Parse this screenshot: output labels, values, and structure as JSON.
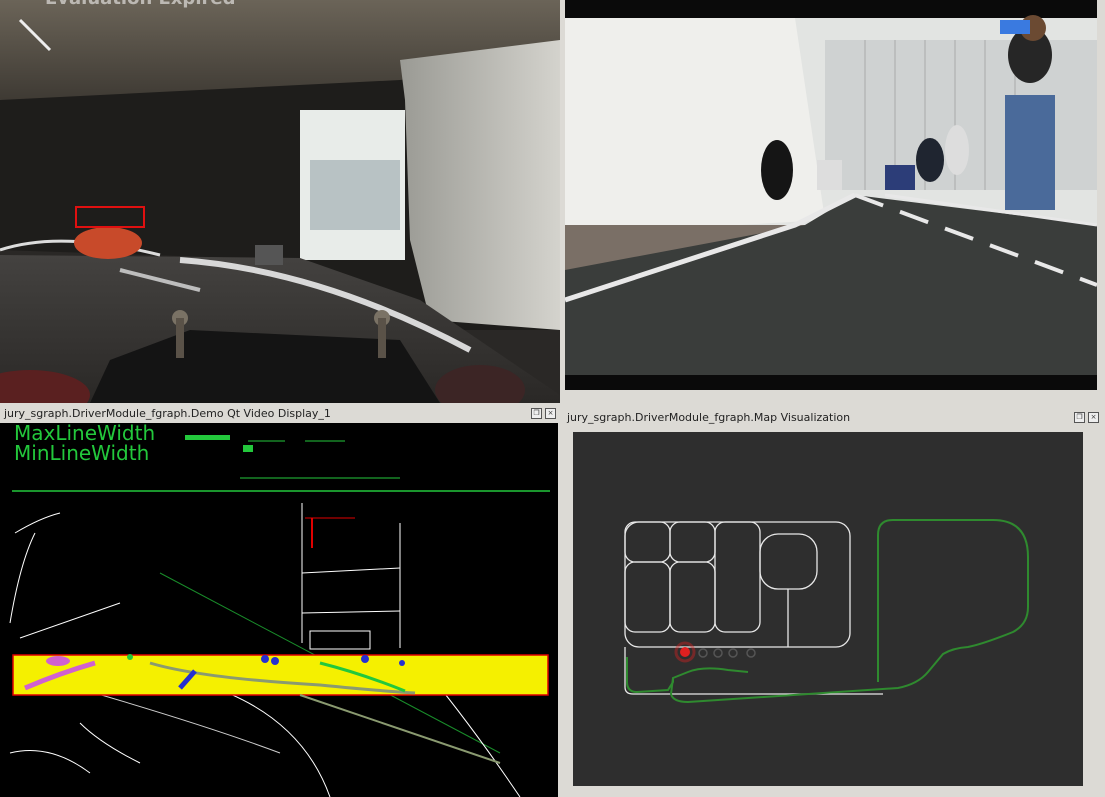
{
  "panels": {
    "cam_left": {
      "watermark": "Evaluation Expired"
    },
    "cam_right": {},
    "video_display": {
      "title": "jury_sgraph.DriverModule_fgraph.Demo Qt Video Display_1",
      "legend_max": "MaxLineWidth",
      "legend_min": "MinLineWidth"
    },
    "map_vis": {
      "title": "jury_sgraph.DriverModule_fgraph.Map Visualization"
    }
  },
  "colors": {
    "window_bg": "#dcdad5",
    "map_bg": "#2e2e2e",
    "track_green": "#2f8a2f",
    "overlay_green": "#23c83c",
    "overlay_yellow": "#f5f000",
    "overlay_red": "#e00000"
  },
  "icons": [
    "restore-icon",
    "close-icon"
  ]
}
